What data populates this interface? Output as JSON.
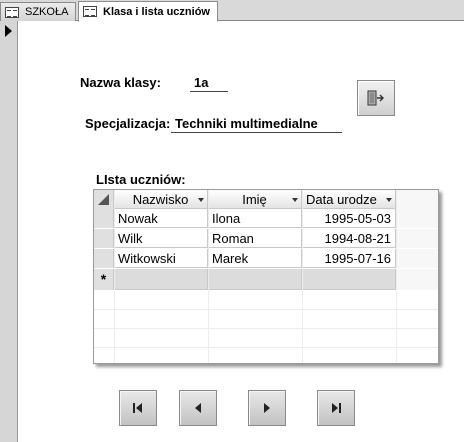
{
  "tabs": [
    {
      "label": "SZKOŁA",
      "icon": "form-icon",
      "active": false
    },
    {
      "label": "Klasa i lista uczniów",
      "icon": "form-icon",
      "active": true
    }
  ],
  "form": {
    "class_name_label": "Nazwa klasy:",
    "class_name_value": "1a",
    "specialization_label": "Specjalizacja:",
    "specialization_value": "Techniki multimedialne",
    "command_button_icon": "exit-door-icon",
    "students_list_label": "LIsta uczniów:"
  },
  "datasheet": {
    "columns": [
      "Nazwisko",
      "Imię",
      "Data urodze"
    ],
    "rows": [
      {
        "nazwisko": "Nowak",
        "imie": "Ilona",
        "data": "1995-05-03"
      },
      {
        "nazwisko": "Wilk",
        "imie": "Roman",
        "data": "1994-08-21"
      },
      {
        "nazwisko": "Witkowski",
        "imie": "Marek",
        "data": "1995-07-16"
      }
    ],
    "new_record_marker": "*"
  },
  "navigation": [
    {
      "name": "first-record-button",
      "icon": "first-record-icon"
    },
    {
      "name": "previous-record-button",
      "icon": "previous-record-icon"
    },
    {
      "name": "next-record-button",
      "icon": "next-record-icon"
    },
    {
      "name": "last-record-button",
      "icon": "last-record-icon"
    }
  ],
  "colors": {
    "tabstrip": "#d9d9d9",
    "selector_bar": "#d6d6d6",
    "button_face": "#cfcfcf"
  }
}
